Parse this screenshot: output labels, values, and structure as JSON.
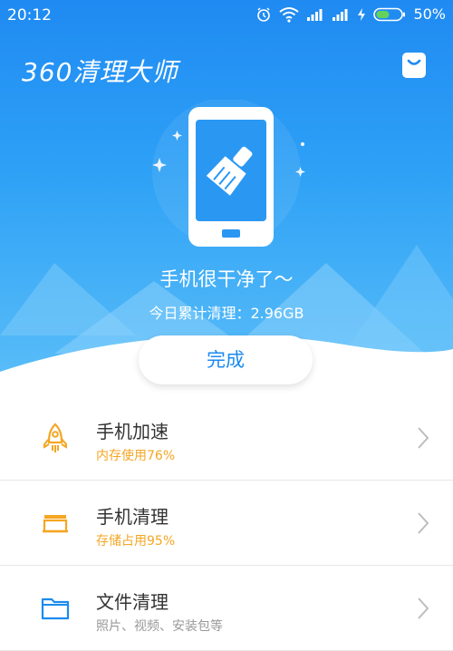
{
  "status": {
    "time": "20:12",
    "battery": "50%"
  },
  "app": {
    "title": "360清理大师"
  },
  "hero": {
    "message": "手机很干净了～",
    "subtext": "今日累计清理：2.96GB",
    "done_label": "完成"
  },
  "list": {
    "items": [
      {
        "title": "手机加速",
        "subtitle": "内存使用76%",
        "icon": "rocket-icon"
      },
      {
        "title": "手机清理",
        "subtitle": "存储占用95%",
        "icon": "storage-icon"
      },
      {
        "title": "文件清理",
        "subtitle": "照片、视频、安装包等",
        "icon": "folder-icon"
      }
    ]
  },
  "colors": {
    "hero_top": "#1f8af2",
    "hero_bottom": "#59bdf8",
    "warning": "#f5a623",
    "accent": "#1b8bee",
    "muted": "#999999"
  }
}
